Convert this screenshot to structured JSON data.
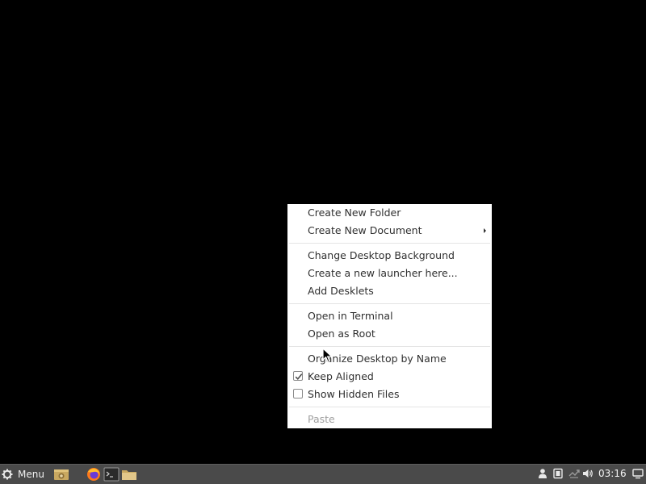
{
  "context_menu": {
    "items": [
      {
        "label": "Create New Folder"
      },
      {
        "label": "Create New Document",
        "submenu": true
      },
      {
        "label": "Change Desktop Background"
      },
      {
        "label": "Create a new launcher here..."
      },
      {
        "label": "Add Desklets"
      },
      {
        "label": "Open in Terminal"
      },
      {
        "label": "Open as Root"
      },
      {
        "label": "Organize Desktop by Name"
      },
      {
        "label": "Keep Aligned",
        "checked": true
      },
      {
        "label": "Show Hidden Files",
        "checked": false
      },
      {
        "label": "Paste",
        "disabled": true
      }
    ]
  },
  "panel": {
    "menu_label": "Menu",
    "menu_icon": "gear-icon",
    "launchers": [
      "show-desktop-icon",
      "firefox-icon",
      "terminal-icon",
      "files-icon"
    ],
    "tray_icons": [
      "user-icon",
      "clipboard-icon",
      "network-icon",
      "volume-icon"
    ],
    "clock": "03:16"
  },
  "colors": {
    "desktop": "#000000",
    "panel": "#4a4a4a",
    "menu_bg": "#ffffff",
    "menu_text": "#303030",
    "disabled_text": "#a0a0a0"
  }
}
